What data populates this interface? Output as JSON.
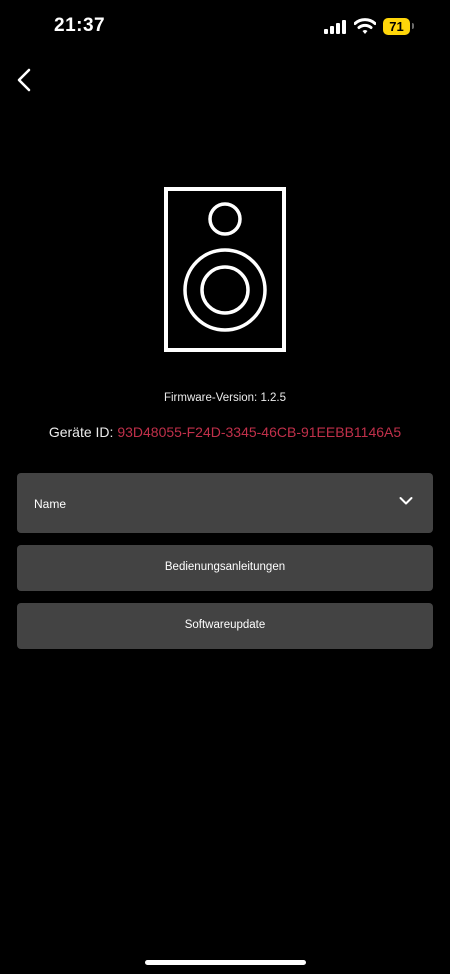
{
  "status_bar": {
    "time": "21:37",
    "battery_level": "71",
    "icons": [
      "cellular-signal-icon",
      "wifi-icon",
      "battery-icon"
    ]
  },
  "nav": {
    "back_icon": "chevron-left-icon"
  },
  "device": {
    "image_icon": "speaker-icon",
    "firmware_text": "Firmware-Version: 1.2.5",
    "id_label": "Geräte ID:",
    "id_value": "93D48055-F24D-3345-46CB-91EEBB1146A5"
  },
  "menu": {
    "name_label": "Name",
    "name_expand_icon": "chevron-down-icon",
    "manuals_label": "Bedienungsanleitungen",
    "update_label": "Softwareupdate"
  },
  "colors": {
    "background": "#000000",
    "panel": "#434343",
    "device_id_accent": "#c0304a",
    "battery": "#ffd60a"
  }
}
